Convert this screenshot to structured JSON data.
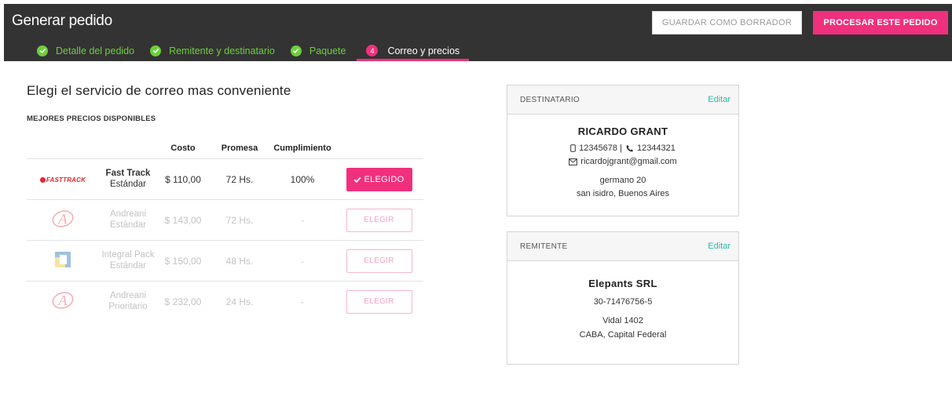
{
  "header": {
    "title": "Generar pedido",
    "draft_label": "GUARDAR COMO BORRADOR",
    "process_label": "PROCESAR ESTE PEDIDO"
  },
  "steps": [
    {
      "label": "Detalle del pedido",
      "status": "done"
    },
    {
      "label": "Remitente y destinatario",
      "status": "done"
    },
    {
      "label": "Paquete",
      "status": "done"
    },
    {
      "number": "4",
      "label": "Correo y precios",
      "status": "active"
    }
  ],
  "main": {
    "title": "Elegi el servicio de correo mas conveniente",
    "subtitle": "MEJORES PRECIOS DISPONIBLES",
    "columns": [
      "Costo",
      "Promesa",
      "Cumplimiento"
    ],
    "rows": [
      {
        "logo": "fasttrack-logo",
        "logo_text": "FASTTRACK",
        "name": "Fast Track",
        "tier": "Estándar",
        "cost": "$ 110,00",
        "promise": "72 Hs.",
        "fulfillment": "100%",
        "action": "ELEGIDO",
        "selected": true
      },
      {
        "logo": "andreani-logo",
        "name": "Andreani",
        "tier": "Estándar",
        "cost": "$ 143,00",
        "promise": "72 Hs.",
        "fulfillment": "-",
        "action": "ELEGIR",
        "selected": false
      },
      {
        "logo": "integral-pack-logo",
        "name": "Integral Pack",
        "tier": "Estándar",
        "cost": "$ 150,00",
        "promise": "48 Hs.",
        "fulfillment": "-",
        "action": "ELEGIR",
        "selected": false
      },
      {
        "logo": "andreani-logo",
        "name": "Andreani",
        "tier": "Prioritario",
        "cost": "$ 232,00",
        "promise": "24 Hs.",
        "fulfillment": "-",
        "action": "ELEGIR",
        "selected": false
      }
    ]
  },
  "recipient": {
    "label": "DESTINATARIO",
    "edit": "Editar",
    "name": "RICARDO GRANT",
    "phones": "12345678 |",
    "phone2": "12344321",
    "email": "ricardojgrant@gmail.com",
    "address1": "germano 20",
    "address2": "san isidro, Buenos Aires"
  },
  "sender": {
    "label": "REMITENTE",
    "edit": "Editar",
    "name": "Elepants SRL",
    "tax_id": "30-71476756-5",
    "address1": "Vidal 1402",
    "address2": "CABA, Capital Federal"
  },
  "colors": {
    "accent": "#f0307d",
    "success": "#6bcf3c",
    "link": "#2bb7a8",
    "header_bg": "#333333"
  }
}
